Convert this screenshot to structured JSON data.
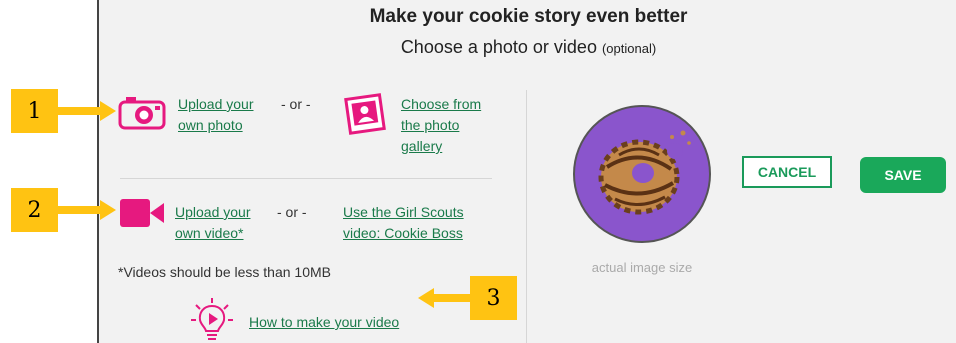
{
  "dialog": {
    "title": "Make your cookie story even better",
    "subtitle": "Choose a photo or video",
    "subtitle_optional": "(optional)"
  },
  "photo": {
    "upload_label": "Upload your own photo",
    "upload_line1": "Upload your",
    "upload_line2": "own photo",
    "or": "- or -",
    "gallery_line1": "Choose from",
    "gallery_line2": "the photo",
    "gallery_line3": "gallery"
  },
  "video": {
    "upload_line1": "Upload your",
    "upload_line2": "own video*",
    "or": "- or -",
    "gs_line1": "Use the Girl Scouts",
    "gs_line2": "video: Cookie Boss"
  },
  "note": "*Videos should be less than 10MB",
  "howto_label": "How to make your video",
  "preview": {
    "caption": "actual image size"
  },
  "buttons": {
    "cancel": "CANCEL",
    "save": "SAVE"
  },
  "callouts": [
    "1",
    "2",
    "3"
  ],
  "colors": {
    "accent_pink": "#e6197f",
    "link_green": "#1a7a4a",
    "save_green": "#1aa85a",
    "callout_yellow": "#ffc312",
    "preview_purple": "#8a55cc"
  },
  "icons": [
    "camera-icon",
    "photo-gallery-icon",
    "video-camera-icon",
    "lightbulb-play-icon"
  ]
}
